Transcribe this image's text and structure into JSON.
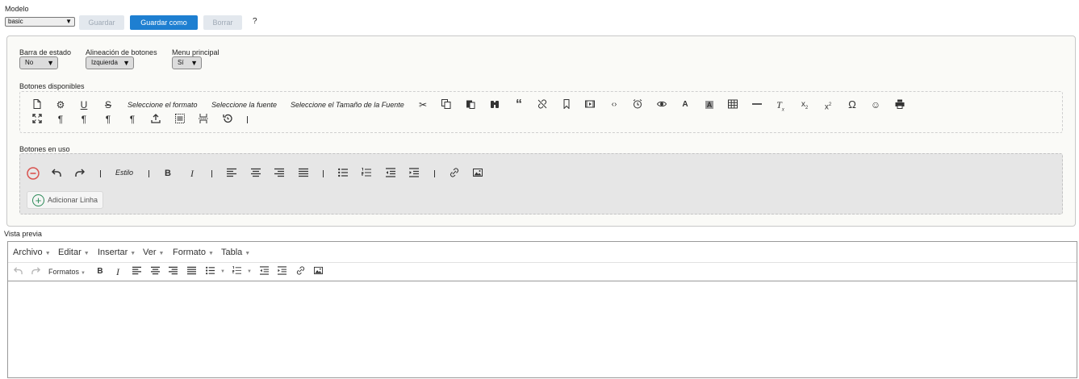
{
  "model": {
    "label": "Modelo",
    "selected": "basic",
    "buttons": {
      "save": "Guardar",
      "save_as": "Guardar como",
      "delete": "Borrar"
    },
    "help": "?"
  },
  "settings": {
    "status_bar": {
      "label": "Barra de estado",
      "value": "No"
    },
    "button_alignment": {
      "label": "Alineación de botones",
      "value": "Izquierda"
    },
    "main_menu": {
      "label": "Menu principal",
      "value": "Sí"
    }
  },
  "available": {
    "label": "Botones disponibles",
    "format_select": "Seleccione el formato",
    "font_select": "Seleccione la fuente",
    "size_select": "Seleccione el Tamaño de la Fuente"
  },
  "in_use": {
    "label": "Botones en uso",
    "style": "Estilo",
    "add_line": "Adicionar Linha"
  },
  "preview": {
    "label": "Vista previa",
    "menus": [
      "Archivo",
      "Editar",
      "Insertar",
      "Ver",
      "Formato",
      "Tabla"
    ],
    "formats": "Formatos"
  },
  "colors": {
    "primary": "#1e7fd1",
    "disabled": "#e3e8ee",
    "remove": "#d9534f",
    "add": "#2c8a58"
  }
}
